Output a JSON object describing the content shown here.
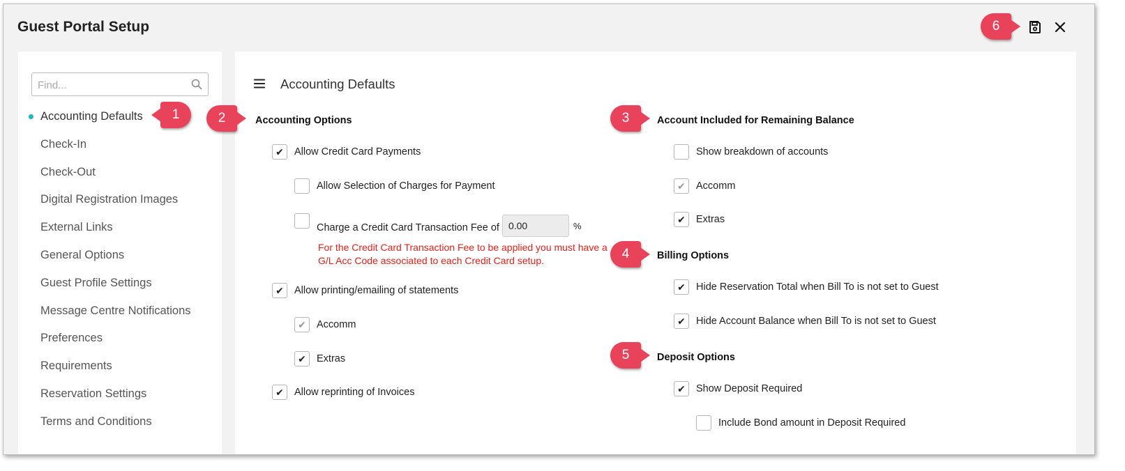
{
  "window": {
    "title": "Guest Portal Setup"
  },
  "header": {
    "save_icon": "save-icon",
    "close_icon": "close-icon"
  },
  "sidebar": {
    "search_placeholder": "Find...",
    "items": [
      {
        "label": "Accounting Defaults",
        "active": true
      },
      {
        "label": "Check-In"
      },
      {
        "label": "Check-Out"
      },
      {
        "label": "Digital Registration Images"
      },
      {
        "label": "External Links"
      },
      {
        "label": "General Options"
      },
      {
        "label": "Guest Profile Settings"
      },
      {
        "label": "Message Centre Notifications"
      },
      {
        "label": "Preferences"
      },
      {
        "label": "Requirements"
      },
      {
        "label": "Reservation Settings"
      },
      {
        "label": "Terms and Conditions"
      }
    ]
  },
  "main": {
    "title": "Accounting Defaults",
    "accounting_options": {
      "title": "Accounting Options",
      "allow_cc": {
        "label": "Allow Credit Card Payments",
        "checked": true
      },
      "allow_selection": {
        "label": "Allow Selection of Charges for Payment",
        "checked": false
      },
      "cc_fee": {
        "label": "Charge a Credit Card Transaction Fee of",
        "checked": false,
        "value": "0.00",
        "unit": "%"
      },
      "warning_line1": "For the Credit Card Transaction Fee to be applied you must have a",
      "warning_line2": "G/L Acc Code associated to each Credit Card setup.",
      "allow_printing": {
        "label": "Allow printing/emailing of statements",
        "checked": true
      },
      "accomm": {
        "label": "Accomm",
        "checked": true,
        "disabled": true
      },
      "extras": {
        "label": "Extras",
        "checked": true
      },
      "allow_reprint": {
        "label": "Allow reprinting of Invoices",
        "checked": true
      }
    },
    "remaining_balance": {
      "title": "Account Included for Remaining Balance",
      "show_breakdown": {
        "label": "Show breakdown of accounts",
        "checked": false
      },
      "accomm": {
        "label": "Accomm",
        "checked": true,
        "disabled": true
      },
      "extras": {
        "label": "Extras",
        "checked": true
      }
    },
    "billing_options": {
      "title": "Billing Options",
      "hide_res_total": {
        "label": "Hide Reservation Total when Bill To is not set to Guest",
        "checked": true
      },
      "hide_acc_balance": {
        "label": "Hide Account Balance when Bill To is not set to Guest",
        "checked": true
      }
    },
    "deposit_options": {
      "title": "Deposit Options",
      "show_deposit": {
        "label": "Show Deposit Required",
        "checked": true
      },
      "include_bond": {
        "label": "Include Bond amount in Deposit Required",
        "checked": false
      }
    }
  },
  "callouts": [
    "1",
    "2",
    "3",
    "4",
    "5",
    "6"
  ],
  "colors": {
    "accent": "#1fb5c2",
    "callout": "#e8435a",
    "warning": "#e0221a"
  }
}
